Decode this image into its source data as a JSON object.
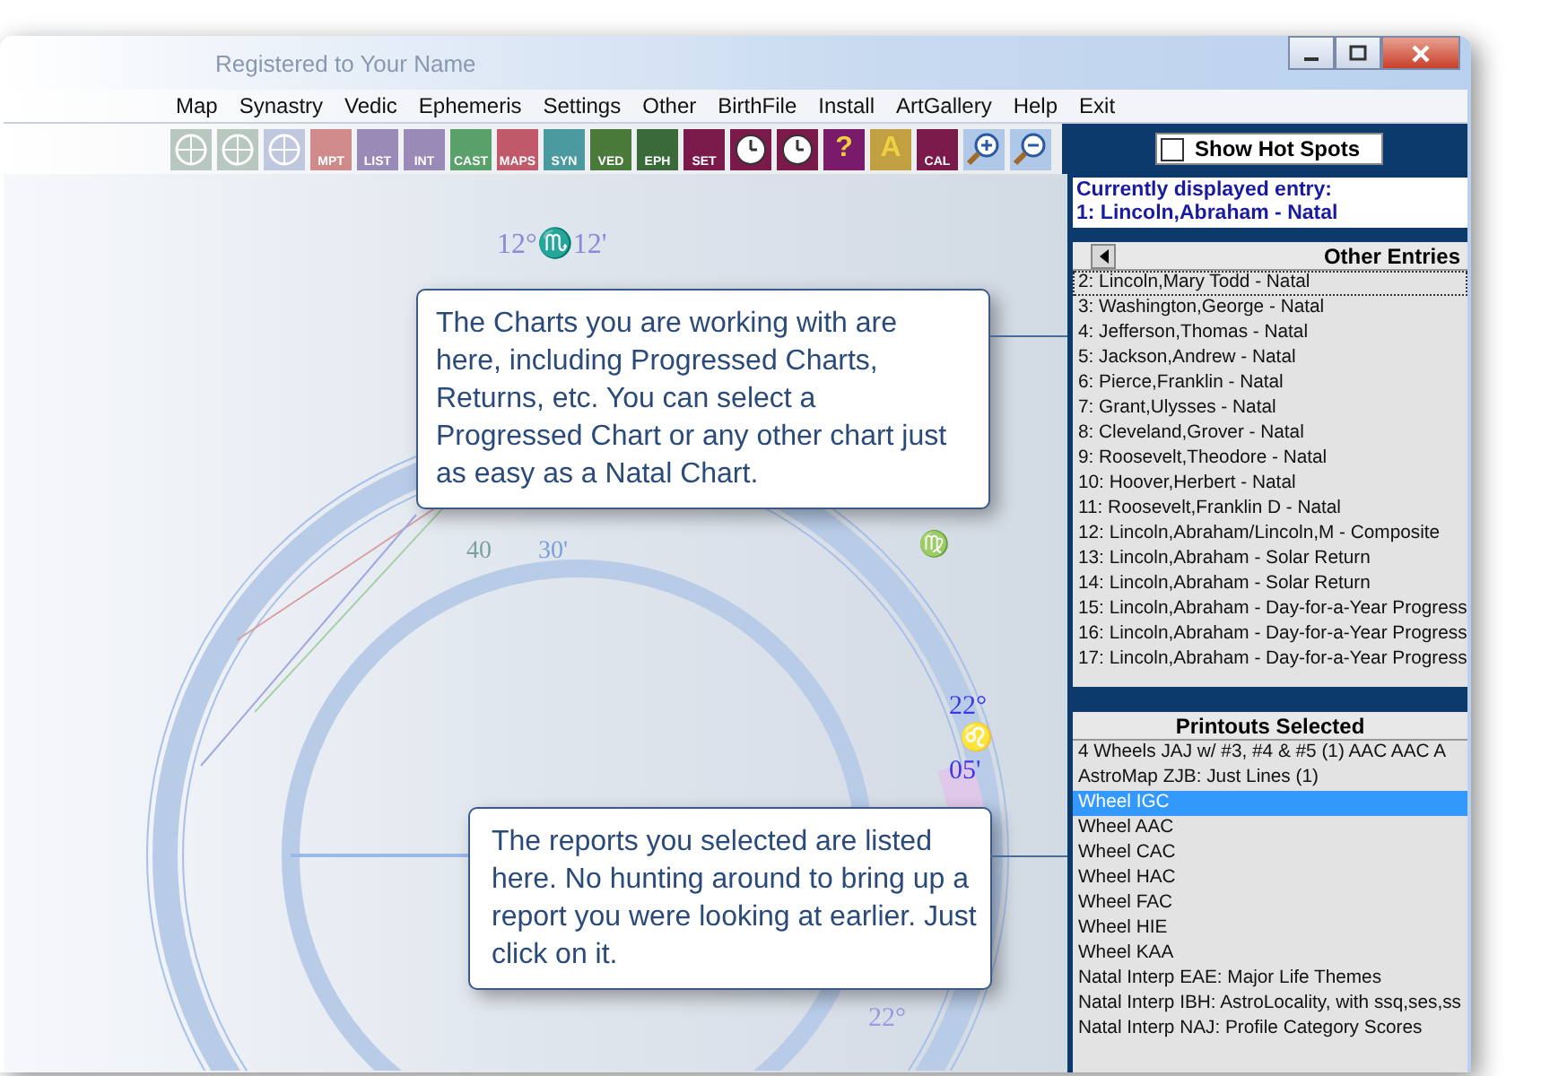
{
  "window": {
    "title": "Registered to Your Name"
  },
  "menu": [
    {
      "label": "Map"
    },
    {
      "label": "Synastry"
    },
    {
      "label": "Vedic"
    },
    {
      "label": "Ephemeris"
    },
    {
      "label": "Settings"
    },
    {
      "label": "Other"
    },
    {
      "label": "BirthFile"
    },
    {
      "label": "Install"
    },
    {
      "label": "ArtGallery"
    },
    {
      "label": "Help"
    },
    {
      "label": "Exit"
    }
  ],
  "toolbar": [
    {
      "kind": "plain",
      "color": "#b8c8c0"
    },
    {
      "kind": "plain",
      "color": "#b8c8c0"
    },
    {
      "kind": "plain",
      "color": "#c0c8e0"
    },
    {
      "kind": "labeled",
      "label": "MPT",
      "color": "#d08a8a"
    },
    {
      "kind": "labeled",
      "label": "LIST",
      "color": "#9a8ab8"
    },
    {
      "kind": "labeled",
      "label": "INT",
      "color": "#9a8ab8"
    },
    {
      "kind": "labeled",
      "label": "CAST",
      "color": "#5aa06a"
    },
    {
      "kind": "labeled",
      "label": "MAPS",
      "color": "#c05a6a"
    },
    {
      "kind": "labeled",
      "label": "SYN",
      "color": "#4a9aa0"
    },
    {
      "kind": "labeled",
      "label": "VED",
      "color": "#4a7a3a"
    },
    {
      "kind": "labeled",
      "label": "EPH",
      "color": "#3a6a3a"
    },
    {
      "kind": "labeled",
      "label": "SET",
      "color": "#7a1a4a"
    },
    {
      "kind": "clock",
      "color": "#7a1a4a"
    },
    {
      "kind": "clock",
      "color": "#7a1a4a"
    },
    {
      "kind": "glyph",
      "label": "?",
      "color": "#7a1a6a"
    },
    {
      "kind": "glyph",
      "label": "A",
      "color": "#c0a040"
    },
    {
      "kind": "labeled",
      "label": "CAL",
      "color": "#7a1a4a"
    },
    {
      "kind": "zoom-in",
      "color": "#b0c8e8"
    },
    {
      "kind": "zoom-out",
      "color": "#b0c8e8"
    }
  ],
  "hot_spots": {
    "label": "Show Hot Spots",
    "checked": false
  },
  "chart": {
    "labels": [
      "12°♏12'",
      "40",
      "30'",
      "22°",
      "♌",
      "05'",
      "22°",
      "♍"
    ]
  },
  "current_entry": {
    "heading": "Currently displayed entry:",
    "value": "1: Lincoln,Abraham - Natal"
  },
  "other_entries": {
    "title": "Other Entries",
    "items": [
      {
        "text": "2: Lincoln,Mary Todd - Natal",
        "focused": true
      },
      {
        "text": "3: Washington,George - Natal",
        "focused": false
      },
      {
        "text": "4: Jefferson,Thomas - Natal",
        "focused": false
      },
      {
        "text": "5: Jackson,Andrew - Natal",
        "focused": false
      },
      {
        "text": "6: Pierce,Franklin - Natal",
        "focused": false
      },
      {
        "text": "7: Grant,Ulysses - Natal",
        "focused": false
      },
      {
        "text": "8: Cleveland,Grover - Natal",
        "focused": false
      },
      {
        "text": "9: Roosevelt,Theodore - Natal",
        "focused": false
      },
      {
        "text": "10: Hoover,Herbert - Natal",
        "focused": false
      },
      {
        "text": "11: Roosevelt,Franklin D - Natal",
        "focused": false
      },
      {
        "text": "12: Lincoln,Abraham/Lincoln,M - Composite",
        "focused": false
      },
      {
        "text": "13: Lincoln,Abraham - Solar Return",
        "focused": false
      },
      {
        "text": "14: Lincoln,Abraham - Solar Return",
        "focused": false
      },
      {
        "text": "15: Lincoln,Abraham - Day-for-a-Year Progress",
        "focused": false
      },
      {
        "text": "16: Lincoln,Abraham - Day-for-a-Year Progress",
        "focused": false
      },
      {
        "text": "17: Lincoln,Abraham - Day-for-a-Year Progress",
        "focused": false
      }
    ]
  },
  "printouts": {
    "title": "Printouts Selected",
    "items": [
      {
        "text": "4 Wheels JAJ w/ #3, #4 & #5 (1) AAC AAC A",
        "selected": false
      },
      {
        "text": "AstroMap ZJB: Just Lines (1)",
        "selected": false
      },
      {
        "text": "Wheel IGC",
        "selected": true
      },
      {
        "text": "Wheel AAC",
        "selected": false
      },
      {
        "text": "Wheel CAC",
        "selected": false
      },
      {
        "text": "Wheel HAC",
        "selected": false
      },
      {
        "text": "Wheel FAC",
        "selected": false
      },
      {
        "text": "Wheel HIE",
        "selected": false
      },
      {
        "text": "Wheel KAA",
        "selected": false
      },
      {
        "text": "Natal Interp EAE: Major Life Themes",
        "selected": false
      },
      {
        "text": "Natal Interp IBH: AstroLocality, with ssq,ses,ss",
        "selected": false
      },
      {
        "text": "Natal Interp NAJ: Profile Category Scores",
        "selected": false
      }
    ]
  },
  "callouts": [
    "The Charts you are working with are here, including Progressed Charts, Returns, etc. You can select a Progressed Chart or any other chart just as easy as a Natal Chart.",
    "The reports you selected are listed here. No hunting around to bring up a report you were looking at earlier. Just click on it."
  ]
}
